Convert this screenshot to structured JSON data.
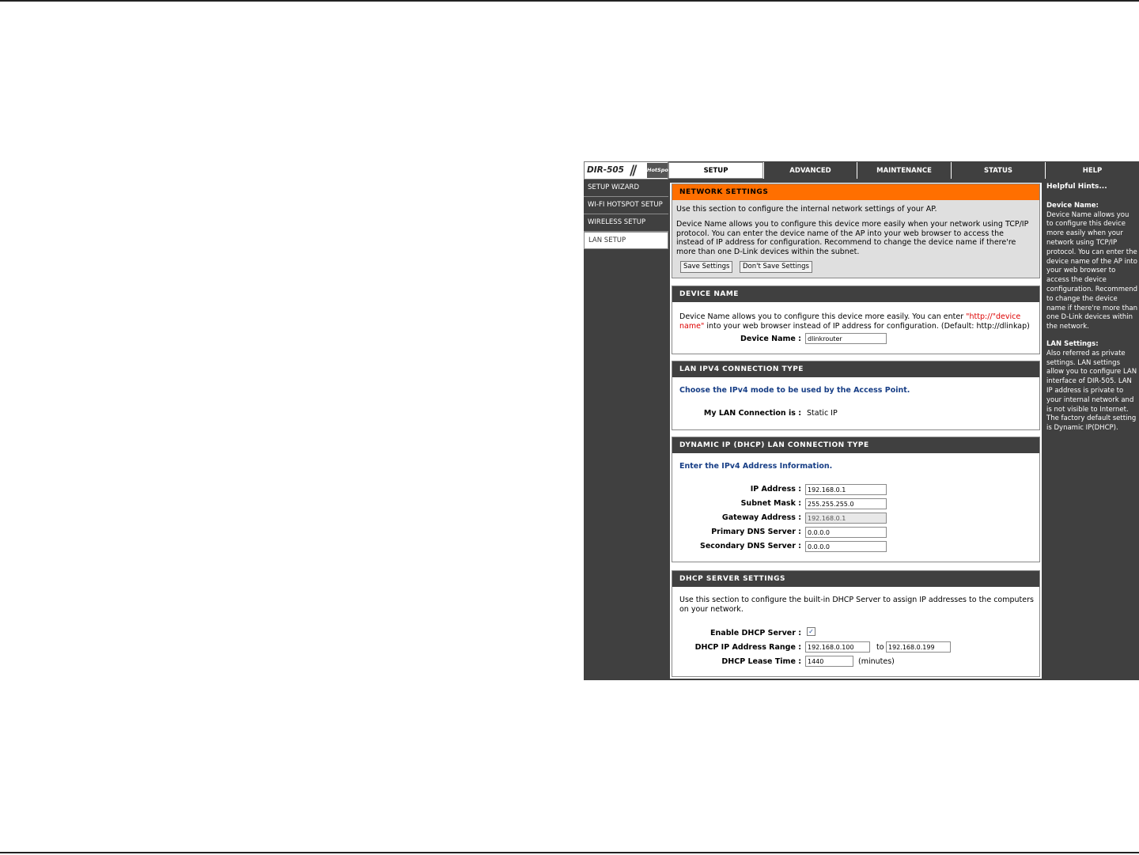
{
  "logo": {
    "model": "DIR-505",
    "slashes": "//",
    "sub": "HotSpot"
  },
  "tabs": [
    "SETUP",
    "ADVANCED",
    "MAINTENANCE",
    "STATUS",
    "HELP"
  ],
  "sidebar": [
    "SETUP WIZARD",
    "WI-FI HOTSPOT SETUP",
    "WIRELESS SETUP",
    "LAN SETUP"
  ],
  "network": {
    "title": "NETWORK SETTINGS",
    "intro": "Use this section to configure the internal network settings of your AP.",
    "desc": "Device Name allows you to configure this device more easily when your network using TCP/IP protocol. You can enter the device name of the AP into your web browser to access the instead of IP address for configuration. Recommend to change the device name if there're more than one D-Link devices within the subnet.",
    "save": "Save Settings",
    "dontsave": "Don't Save Settings"
  },
  "device": {
    "title": "DEVICE NAME",
    "desc1": "Device Name allows you to configure this device more easily. You can enter ",
    "url": "\"http://\"device name\"",
    "desc2": " into your web browser instead of IP address for configuration.  (Default: http://dlinkap)",
    "label": "Device Name :",
    "value": "dlinkrouter"
  },
  "ipv4": {
    "title": "LAN IPV4 CONNECTION TYPE",
    "choose": "Choose the IPv4 mode to be used by the Access Point.",
    "label": "My LAN Connection is :",
    "value": "Static IP"
  },
  "dhcp_type": {
    "title": "DYNAMIC IP (DHCP) LAN CONNECTION TYPE",
    "enter": "Enter the IPv4 Address Information.",
    "ip_label": "IP Address :",
    "ip": "192.168.0.1",
    "mask_label": "Subnet Mask :",
    "mask": "255.255.255.0",
    "gw_label": "Gateway Address :",
    "gw": "192.168.0.1",
    "dns1_label": "Primary DNS Server :",
    "dns1": "0.0.0.0",
    "dns2_label": "Secondary DNS Server :",
    "dns2": "0.0.0.0"
  },
  "dhcp_server": {
    "title": "DHCP SERVER SETTINGS",
    "desc": "Use this section to configure the built-in DHCP Server to assign IP addresses to the computers on your network.",
    "enable_label": "Enable DHCP Server :",
    "range_label": "DHCP IP Address Range :",
    "range_from": "192.168.0.100",
    "to": "to",
    "range_to": "192.168.0.199",
    "lease_label": "DHCP Lease Time :",
    "lease": "1440",
    "minutes": "(minutes)"
  },
  "help": {
    "title": "Helpful Hints...",
    "dn_title": "Device Name:",
    "dn_text": "Device Name allows you to configure this device more easily when your network using TCP/IP protocol. You can enter the device name of the AP into your web browser to access the device configuration. Recommend to change the device name if there're more than one D-Link devices within the network.",
    "lan_title": "LAN Settings:",
    "lan_text": "Also referred as private settings. LAN settings allow you to configure LAN interface of DIR-505. LAN IP address is private to your internal network and is not visible to Internet. The factory default setting is Dynamic IP(DHCP)."
  }
}
